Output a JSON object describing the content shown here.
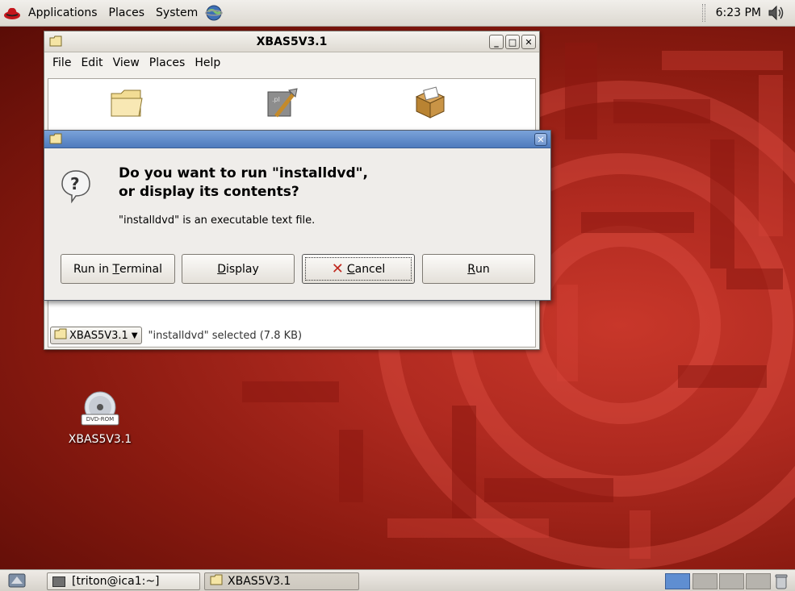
{
  "top_panel": {
    "menus": [
      "Applications",
      "Places",
      "System"
    ],
    "clock": "6:23 PM"
  },
  "browser_window": {
    "title": "XBAS5V3.1",
    "menu": [
      "File",
      "Edit",
      "View",
      "Places",
      "Help"
    ],
    "location_button": "XBAS5V3.1",
    "status": "\"installdvd\" selected (7.8 KB)"
  },
  "dialog": {
    "heading_line1": "Do you want to run \"installdvd\",",
    "heading_line2": "or display its contents?",
    "subtext": "\"installdvd\" is an executable text file.",
    "buttons": {
      "run_in_terminal_pre": "Run in ",
      "run_in_terminal_u": "T",
      "run_in_terminal_post": "erminal",
      "display_u": "D",
      "display_post": "isplay",
      "cancel_u": "C",
      "cancel_post": "ancel",
      "run_u": "R",
      "run_post": "un"
    }
  },
  "desktop_icon": {
    "badge": "DVD-ROM",
    "label": "XBAS5V3.1"
  },
  "taskbar": {
    "terminal": "[triton@ica1:~]",
    "browser": "XBAS5V3.1"
  },
  "colors": {
    "accent_titlebar": "#5a85c5",
    "wallpaper": "#b02a20"
  }
}
